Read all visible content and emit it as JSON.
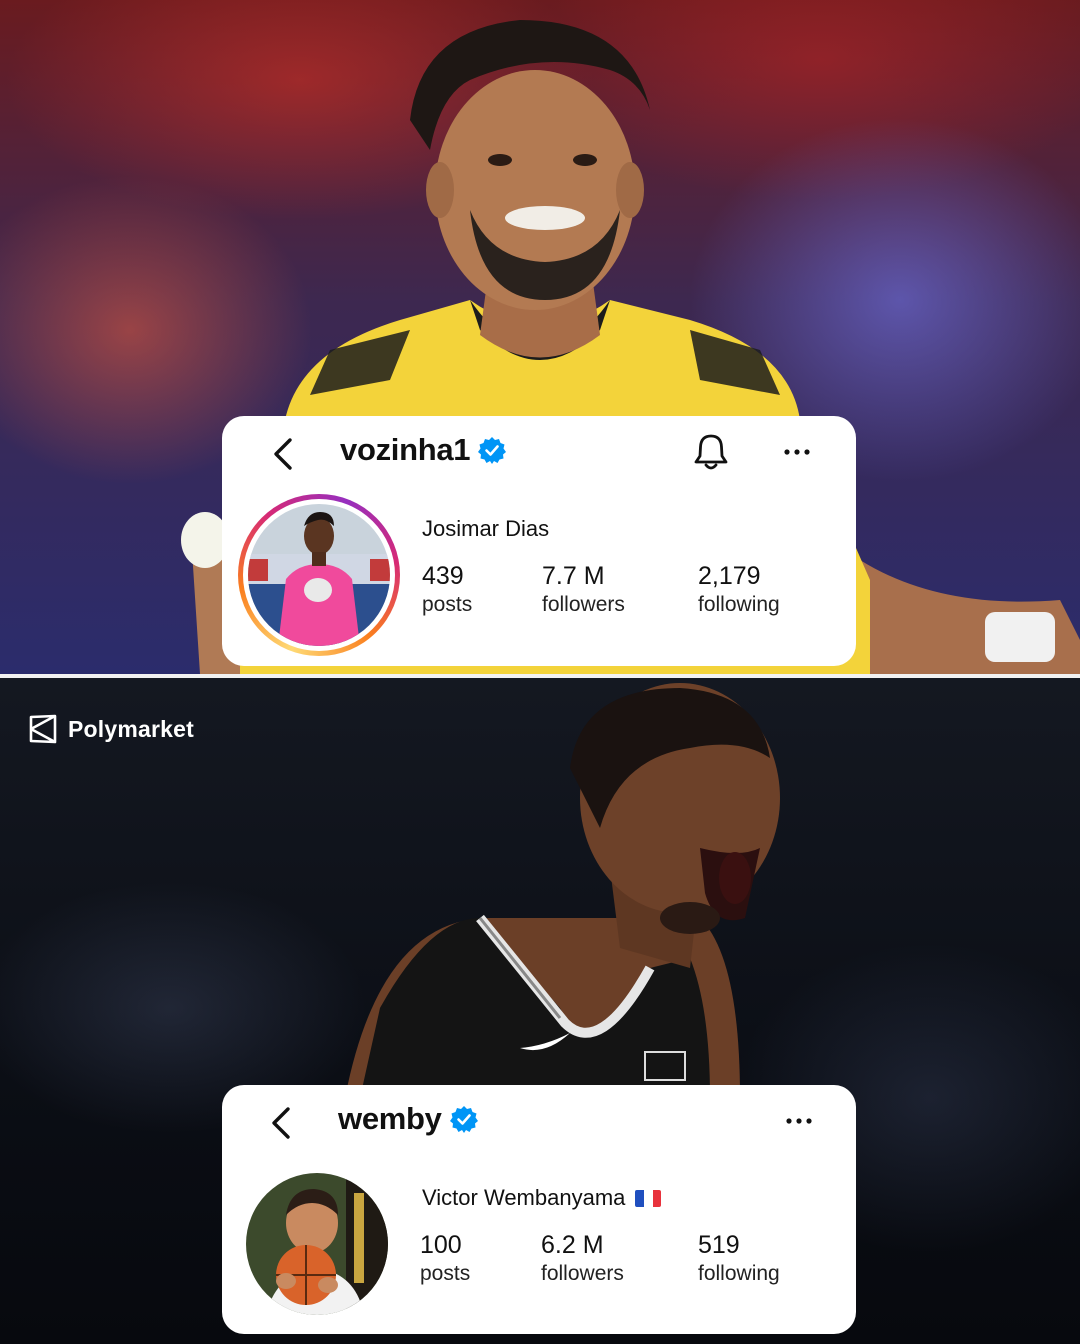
{
  "brand": {
    "name": "Polymarket",
    "icon": "polymarket-logo-icon"
  },
  "profiles": [
    {
      "handle": "vozinha1",
      "verified": true,
      "full_name": "Josimar Dias",
      "flag": "",
      "posts": "439",
      "posts_label": "posts",
      "followers": "7.7 M",
      "followers_label": "followers",
      "following": "2,179",
      "following_label": "following",
      "icons": [
        "back-icon",
        "verified-icon",
        "bell-icon",
        "more-icon"
      ]
    },
    {
      "handle": "wemby",
      "verified": true,
      "full_name": "Victor Wembanyama",
      "flag": "🇫🇷",
      "posts": "100",
      "posts_label": "posts",
      "followers": "6.2 M",
      "followers_label": "followers",
      "following": "519",
      "following_label": "following",
      "icons": [
        "back-icon",
        "verified-icon",
        "more-icon"
      ]
    }
  ],
  "colors": {
    "verified_blue": "#0095f6",
    "card_bg": "#ffffff",
    "text": "#111111"
  }
}
